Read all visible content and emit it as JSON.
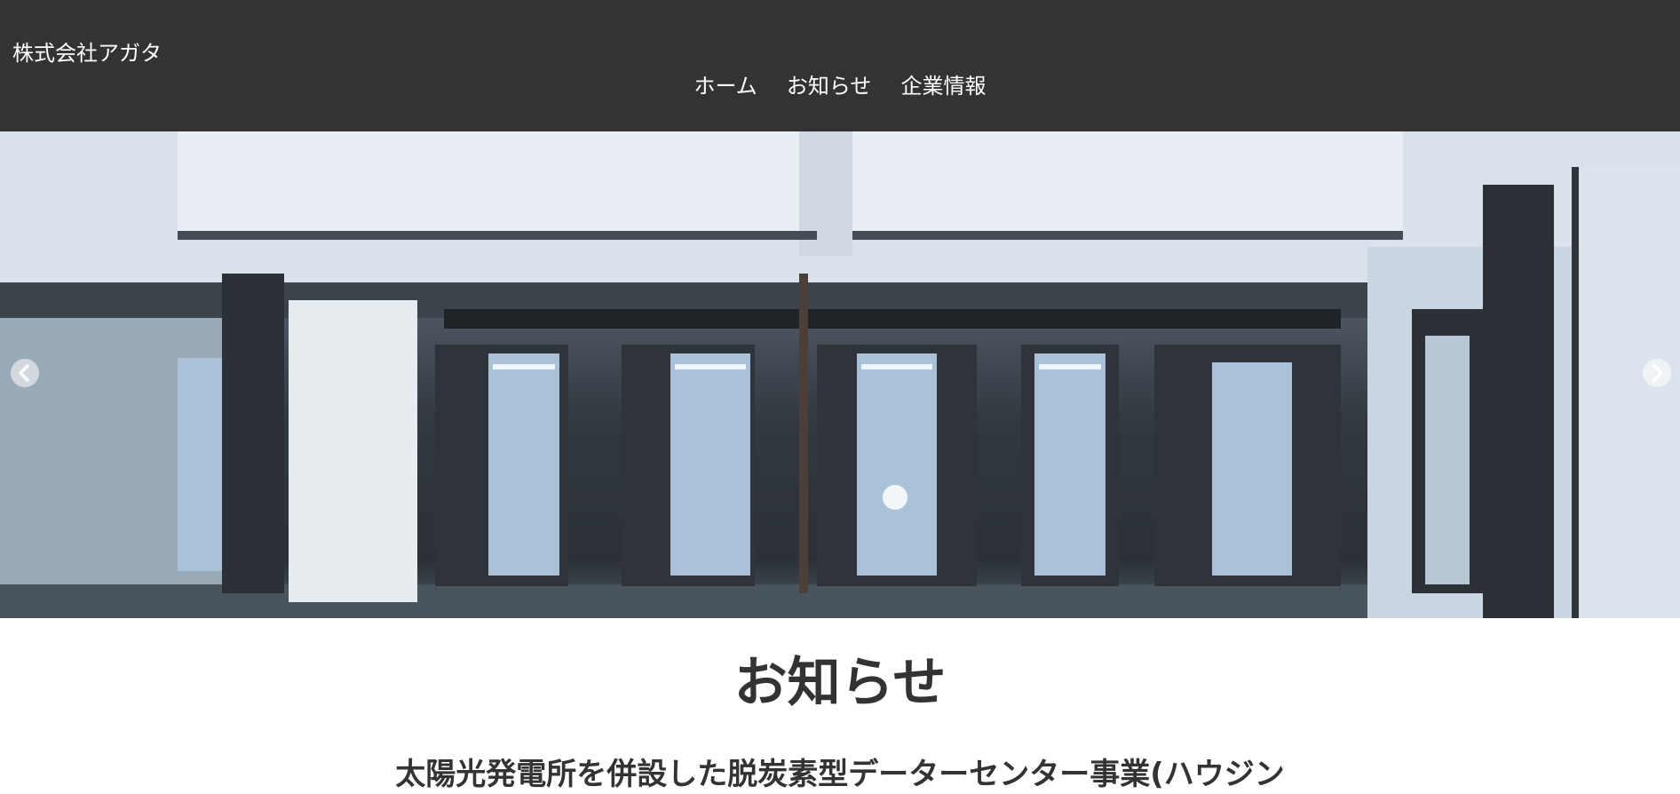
{
  "header": {
    "brand": "株式会社アガタ",
    "nav": [
      {
        "label": "ホーム"
      },
      {
        "label": "お知らせ"
      },
      {
        "label": "企業情報"
      }
    ]
  },
  "hero": {
    "prev_icon": "chevron-left-icon",
    "next_icon": "chevron-right-icon"
  },
  "news": {
    "title": "お知らせ",
    "headline": "太陽光発電所を併設した脱炭素型データーセンター事業(ハウジン"
  },
  "colors": {
    "header_bg": "#333333",
    "header_text": "#ffffff",
    "body_text": "#333333"
  }
}
